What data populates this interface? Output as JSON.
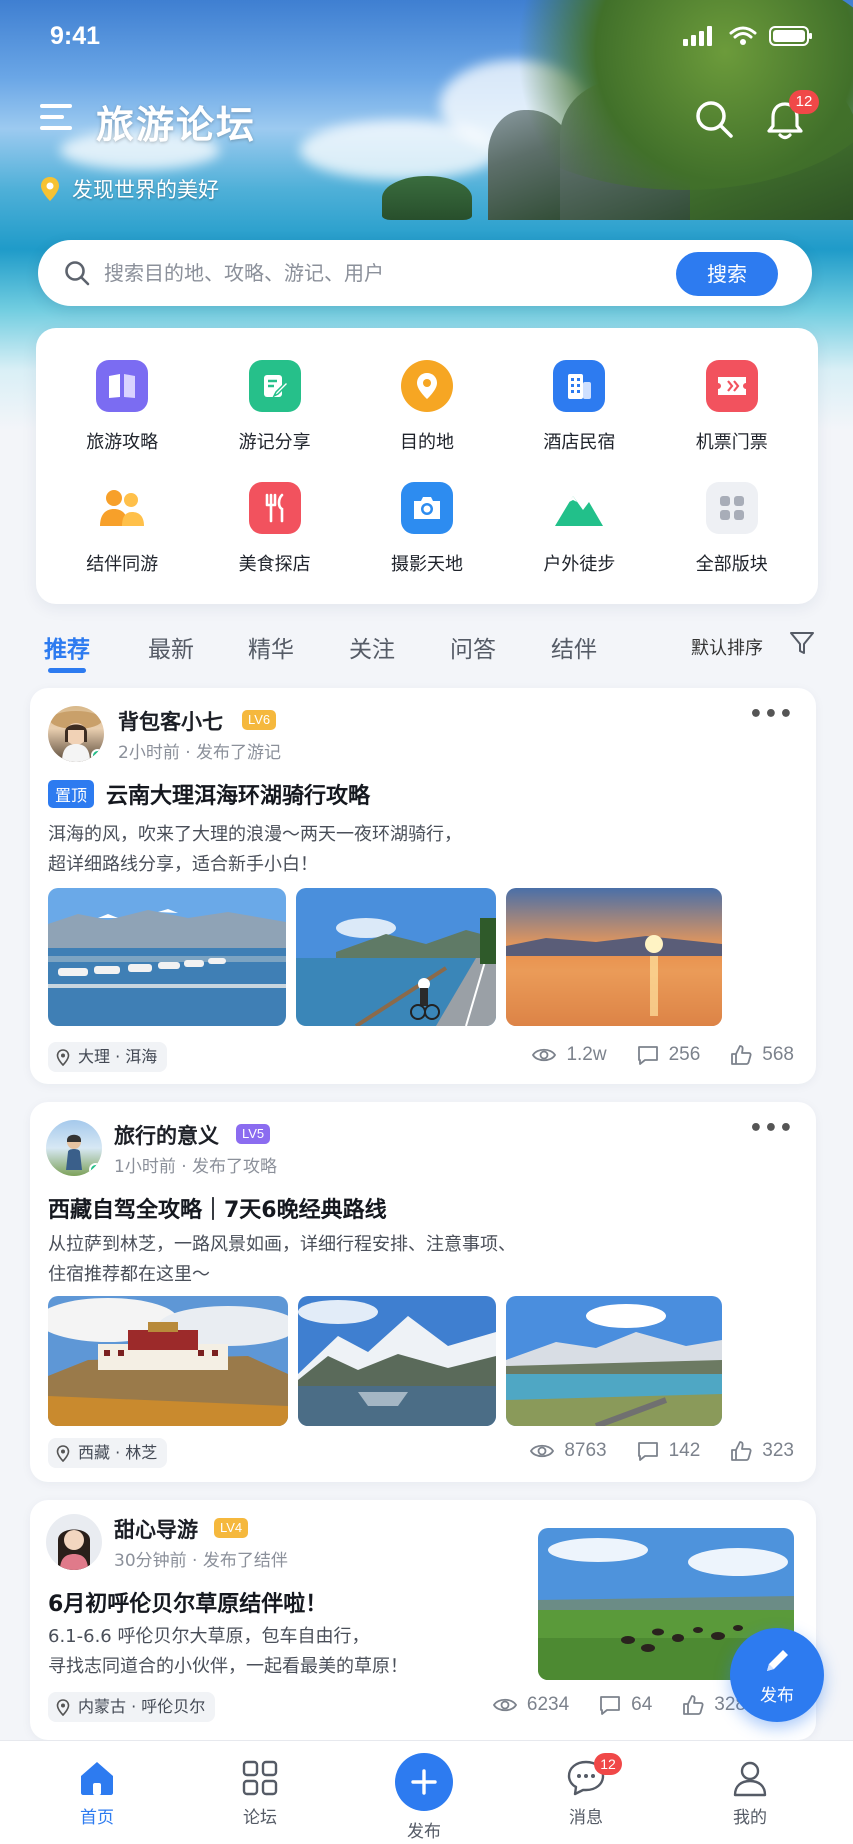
{
  "status_bar": {
    "time": "9:41"
  },
  "header": {
    "title": "旅游论坛",
    "location_text": "发现世界的美好",
    "notification_count": "12"
  },
  "search": {
    "placeholder": "搜索目的地、攻略、游记、用户",
    "button_label": "搜索"
  },
  "categories": [
    {
      "label": "旅游攻略",
      "icon": "book-icon",
      "color": "#7b6cf2"
    },
    {
      "label": "游记分享",
      "icon": "edit-note-icon",
      "color": "#26c08a"
    },
    {
      "label": "目的地",
      "icon": "location-pin-icon",
      "color": "#f6a623"
    },
    {
      "label": "酒店民宿",
      "icon": "building-icon",
      "color": "#2d7bf0"
    },
    {
      "label": "机票门票",
      "icon": "ticket-icon",
      "color": "#f2525e"
    },
    {
      "label": "结伴同游",
      "icon": "people-icon",
      "color": "#f7a02a"
    },
    {
      "label": "美食探店",
      "icon": "fork-knife-icon",
      "color": "#f2525e"
    },
    {
      "label": "摄影天地",
      "icon": "camera-icon",
      "color": "#2d8cf0"
    },
    {
      "label": "户外徒步",
      "icon": "mountain-icon",
      "color": "#22c08a"
    },
    {
      "label": "全部版块",
      "icon": "grid-icon",
      "color": "#a8adb8"
    }
  ],
  "tabs": [
    "推荐",
    "最新",
    "精华",
    "关注",
    "问答",
    "结伴"
  ],
  "sort_label": "默认排序",
  "posts": [
    {
      "author": "背包客小七",
      "level": "LV6",
      "time": "2小时前 · 发布了游记",
      "pinned_label": "置顶",
      "title": "云南大理洱海环湖骑行攻略",
      "desc_line1": "洱海的风，吹来了大理的浪漫～两天一夜环湖骑行，",
      "desc_line2": "超详细路线分享，适合新手小白！",
      "location": "大理 · 洱海",
      "views": "1.2w",
      "comments": "256",
      "likes": "568"
    },
    {
      "author": "旅行的意义",
      "level": "LV5",
      "time": "1小时前 · 发布了攻略",
      "title": "西藏自驾全攻略｜7天6晚经典路线",
      "desc_line1": "从拉萨到林芝，一路风景如画，详细行程安排、注意事项、",
      "desc_line2": "住宿推荐都在这里～",
      "location": "西藏 · 林芝",
      "views": "8763",
      "comments": "142",
      "likes": "323"
    },
    {
      "author": "甜心导游",
      "level": "LV4",
      "time": "30分钟前 · 发布了结伴",
      "title": "6月初呼伦贝尔草原结伴啦！",
      "desc_line1": "6.1-6.6 呼伦贝尔大草原，包车自由行，",
      "desc_line2": "寻找志同道合的小伙伴，一起看最美的草原！",
      "location": "内蒙古 · 呼伦贝尔",
      "views": "6234",
      "comments": "64",
      "likes": "328"
    }
  ],
  "fab_label": "发布",
  "bottom_nav": {
    "home": "首页",
    "forum": "论坛",
    "publish": "发布",
    "messages": "消息",
    "me": "我的",
    "message_count": "12"
  },
  "colors": {
    "primary": "#2d7bf0",
    "badge": "#f04848",
    "lv6": "#f5b83d",
    "lv5": "#8b6cf0",
    "lv4": "#f5b83d"
  }
}
